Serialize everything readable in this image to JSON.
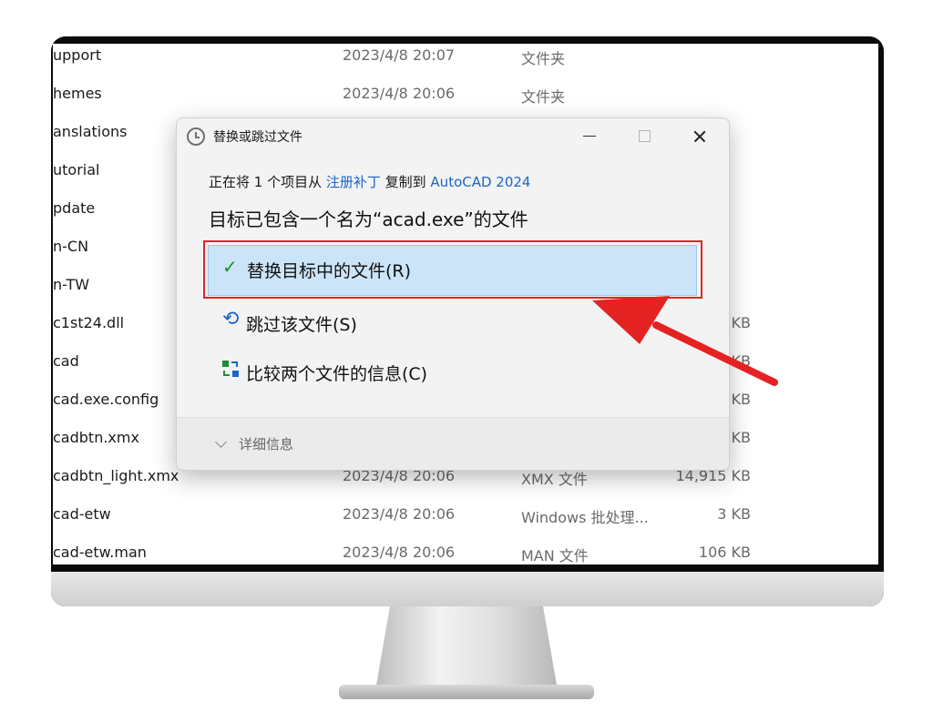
{
  "explorer": {
    "rows": [
      {
        "name": "upport",
        "date": "2023/4/8 20:07",
        "type": "文件夹",
        "size": ""
      },
      {
        "name": "hemes",
        "date": "2023/4/8 20:06",
        "type": "文件夹",
        "size": ""
      },
      {
        "name": "anslations",
        "date": "",
        "type": "",
        "size": ""
      },
      {
        "name": "utorial",
        "date": "",
        "type": "",
        "size": ""
      },
      {
        "name": "pdate",
        "date": "",
        "type": "",
        "size": ""
      },
      {
        "name": "n-CN",
        "date": "",
        "type": "",
        "size": ""
      },
      {
        "name": "n-TW",
        "date": "",
        "type": "",
        "size": ""
      },
      {
        "name": "c1st24.dll",
        "date": "",
        "type": "",
        "size": "KB"
      },
      {
        "name": "cad",
        "date": "",
        "type": "",
        "size": "KB"
      },
      {
        "name": "cad.exe.config",
        "date": "",
        "type": "",
        "size": "KB"
      },
      {
        "name": "cadbtn.xmx",
        "date": "",
        "type": "",
        "size": "KB"
      },
      {
        "name": "cadbtn_light.xmx",
        "date": "2023/4/8 20:06",
        "type": "XMX 文件",
        "size": "14,915 KB"
      },
      {
        "name": "cad-etw",
        "date": "2023/4/8 20:06",
        "type": "Windows 批处理...",
        "size": "3 KB"
      },
      {
        "name": "cad-etw.man",
        "date": "2023/4/8 20:06",
        "type": "MAN 文件",
        "size": "106 KB"
      }
    ]
  },
  "dialog": {
    "title": "替换或跳过文件",
    "status_prefix": "正在将 1 个项目从 ",
    "source": "注册补丁",
    "status_mid": " 复制到 ",
    "destination": "AutoCAD 2024",
    "message": "目标已包含一个名为“acad.exe”的文件",
    "replace_label": "替换目标中的文件(R)",
    "skip_label": "跳过该文件(S)",
    "compare_label": "比较两个文件的信息(C)",
    "details_label": "详细信息"
  },
  "icons": {
    "title": "clock-icon",
    "replace": "checkmark-icon",
    "skip": "undo-arrow-icon",
    "compare": "compare-icon",
    "details": "chevron-down-icon"
  },
  "colors": {
    "link": "#1a66c8",
    "replace_bg": "#cce4f7",
    "highlight": "#e02525",
    "check": "#1e8a3c"
  }
}
